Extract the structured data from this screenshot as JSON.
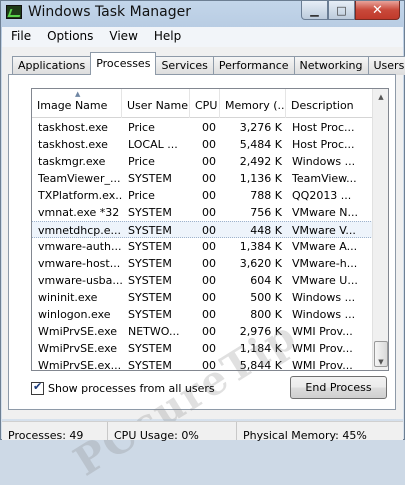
{
  "window": {
    "title": "Windows Task Manager"
  },
  "menu": [
    "File",
    "Options",
    "View",
    "Help"
  ],
  "tabs": [
    "Applications",
    "Processes",
    "Services",
    "Performance",
    "Networking",
    "Users"
  ],
  "active_tab": "Processes",
  "columns": [
    "Image Name",
    "User Name",
    "CPU",
    "Memory (...",
    "Description"
  ],
  "processes": [
    {
      "name": "taskhost.exe",
      "user": "Price",
      "cpu": "00",
      "mem": "3,276 K",
      "desc": "Host Proc..."
    },
    {
      "name": "taskhost.exe",
      "user": "LOCAL ...",
      "cpu": "00",
      "mem": "5,484 K",
      "desc": "Host Proc..."
    },
    {
      "name": "taskmgr.exe",
      "user": "Price",
      "cpu": "00",
      "mem": "2,492 K",
      "desc": "Windows ..."
    },
    {
      "name": "TeamViewer_...",
      "user": "SYSTEM",
      "cpu": "00",
      "mem": "1,136 K",
      "desc": "TeamView..."
    },
    {
      "name": "TXPlatform.ex...",
      "user": "Price",
      "cpu": "00",
      "mem": "788 K",
      "desc": "QQ2013 ..."
    },
    {
      "name": "vmnat.exe *32",
      "user": "SYSTEM",
      "cpu": "00",
      "mem": "756 K",
      "desc": "VMware N..."
    },
    {
      "name": "vmnetdhcp.e...",
      "user": "SYSTEM",
      "cpu": "00",
      "mem": "448 K",
      "desc": "VMware V..."
    },
    {
      "name": "vmware-auth...",
      "user": "SYSTEM",
      "cpu": "00",
      "mem": "1,384 K",
      "desc": "VMware A..."
    },
    {
      "name": "vmware-host...",
      "user": "SYSTEM",
      "cpu": "00",
      "mem": "3,620 K",
      "desc": "VMware-h..."
    },
    {
      "name": "vmware-usba...",
      "user": "SYSTEM",
      "cpu": "00",
      "mem": "604 K",
      "desc": "VMware U..."
    },
    {
      "name": "wininit.exe",
      "user": "SYSTEM",
      "cpu": "00",
      "mem": "500 K",
      "desc": "Windows ..."
    },
    {
      "name": "winlogon.exe",
      "user": "SYSTEM",
      "cpu": "00",
      "mem": "800 K",
      "desc": "Windows ..."
    },
    {
      "name": "WmiPrvSE.exe",
      "user": "NETWO...",
      "cpu": "00",
      "mem": "2,976 K",
      "desc": "WMI Prov..."
    },
    {
      "name": "WmiPrvSE.exe",
      "user": "SYSTEM",
      "cpu": "00",
      "mem": "1,184 K",
      "desc": "WMI Prov..."
    },
    {
      "name": "WmiPrvSE.ex...",
      "user": "SYSTEM",
      "cpu": "00",
      "mem": "5,844 K",
      "desc": "WMI Prov..."
    }
  ],
  "selected_row": 6,
  "show_all_label": "Show processes from all users",
  "show_all_checked": true,
  "end_process_label": "End Process",
  "status": {
    "processes": "Processes: 49",
    "cpu": "CPU Usage: 0%",
    "memory": "Physical Memory: 45%"
  },
  "watermark": "PCcureTip"
}
